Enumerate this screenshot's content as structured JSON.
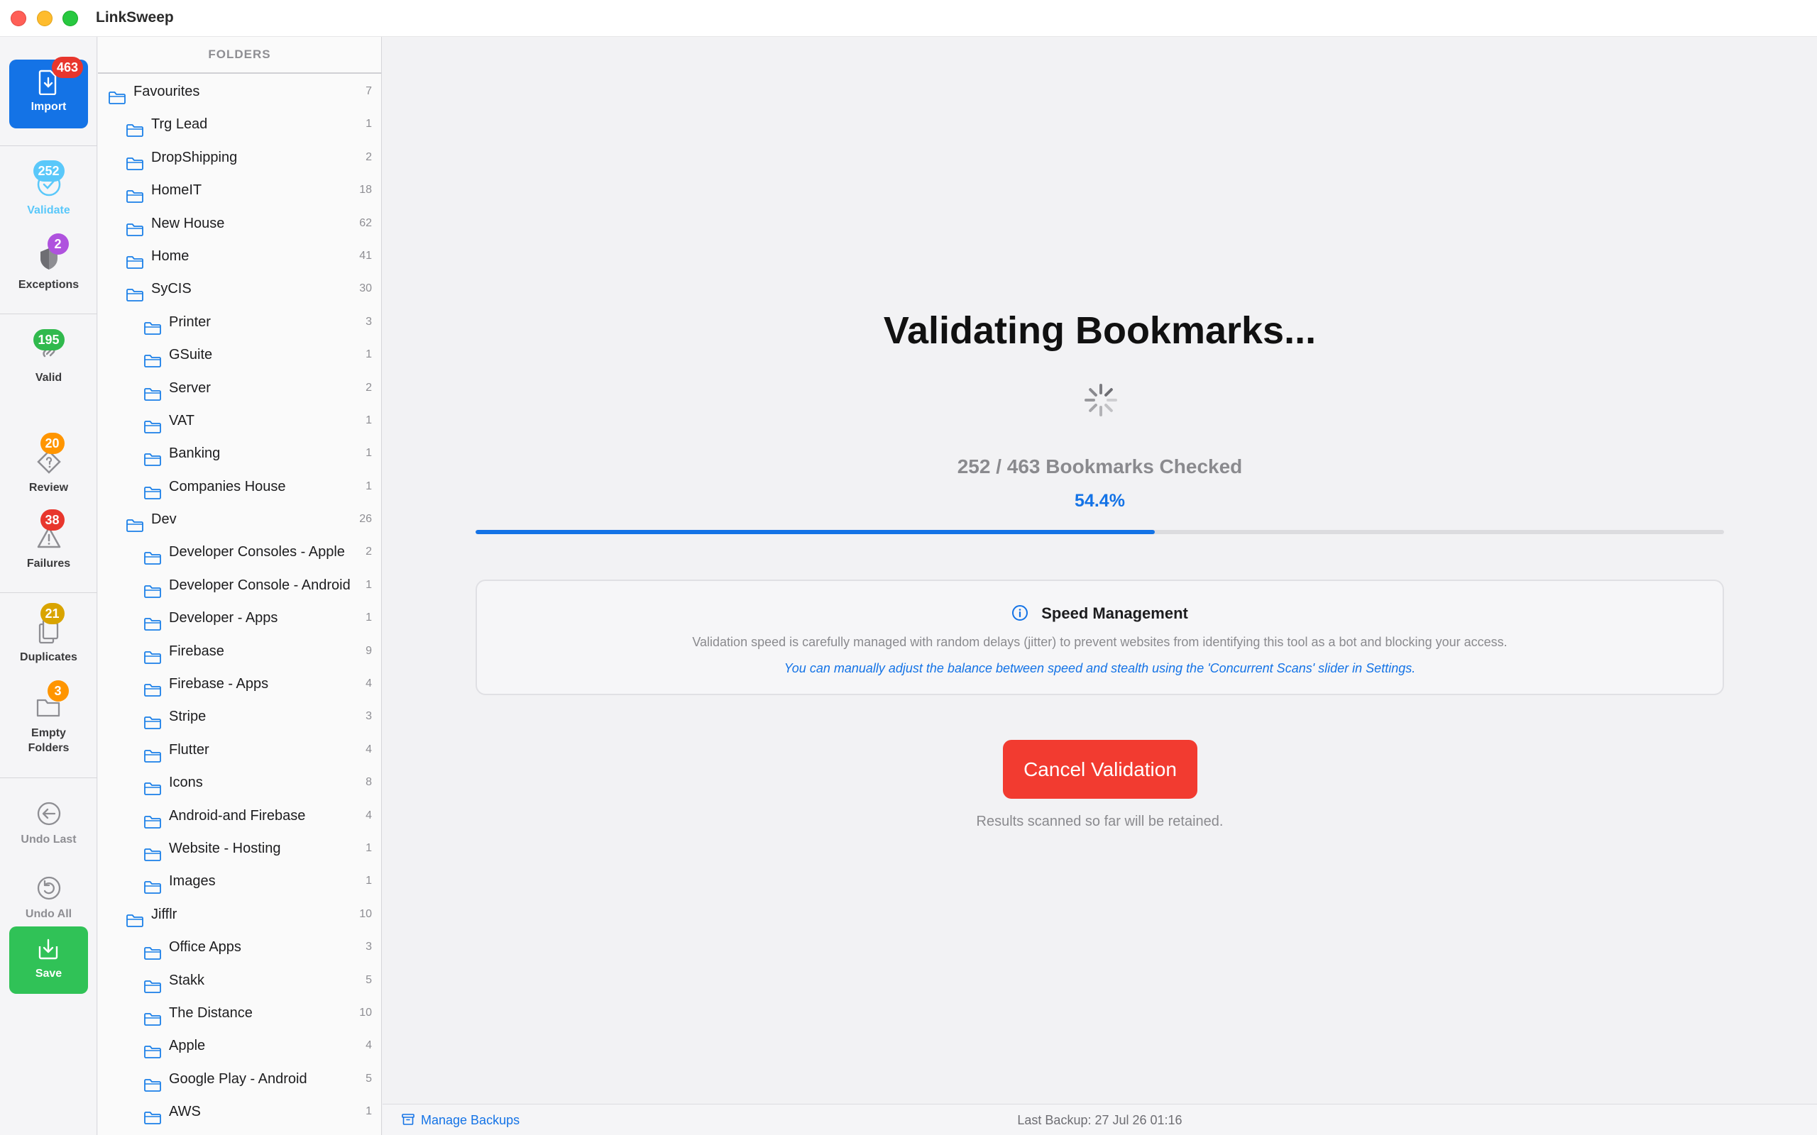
{
  "window": {
    "title": "LinkSweep"
  },
  "rail": {
    "import": {
      "label": "Import",
      "badge": "463",
      "badge_color": "#e8362d"
    },
    "validate": {
      "label": "Validate",
      "badge": "252",
      "badge_color": "#5ac8fa"
    },
    "exceptions": {
      "label": "Exceptions",
      "badge": "2",
      "badge_color": "#af52de"
    },
    "valid": {
      "label": "Valid",
      "badge": "195",
      "badge_color": "#30b94d"
    },
    "review": {
      "label": "Review",
      "badge": "20",
      "badge_color": "#ff9500"
    },
    "failures": {
      "label": "Failures",
      "badge": "38",
      "badge_color": "#e8362d"
    },
    "duplicates": {
      "label": "Duplicates",
      "badge": "21",
      "badge_color": "#d9a400"
    },
    "empty_folders": {
      "label_line1": "Empty",
      "label_line2": "Folders",
      "badge": "3",
      "badge_color": "#ff9500"
    },
    "undo_last": {
      "label": "Undo Last"
    },
    "undo_all": {
      "label": "Undo All"
    },
    "save": {
      "label": "Save"
    }
  },
  "folders": {
    "header": "FOLDERS",
    "items": [
      {
        "name": "Favourites",
        "count": "7",
        "level": 0
      },
      {
        "name": "Trg Lead",
        "count": "1",
        "level": 1
      },
      {
        "name": "DropShipping",
        "count": "2",
        "level": 1
      },
      {
        "name": "HomeIT",
        "count": "18",
        "level": 1
      },
      {
        "name": "New House",
        "count": "62",
        "level": 1
      },
      {
        "name": "Home",
        "count": "41",
        "level": 1
      },
      {
        "name": "SyCIS",
        "count": "30",
        "level": 1
      },
      {
        "name": "Printer",
        "count": "3",
        "level": 2
      },
      {
        "name": "GSuite",
        "count": "1",
        "level": 2
      },
      {
        "name": "Server",
        "count": "2",
        "level": 2
      },
      {
        "name": "VAT",
        "count": "1",
        "level": 2
      },
      {
        "name": "Banking",
        "count": "1",
        "level": 2
      },
      {
        "name": "Companies House",
        "count": "1",
        "level": 2
      },
      {
        "name": "Dev",
        "count": "26",
        "level": 1
      },
      {
        "name": "Developer Consoles - Apple",
        "count": "2",
        "level": 2
      },
      {
        "name": "Developer Console - Android",
        "count": "1",
        "level": 2
      },
      {
        "name": "Developer - Apps",
        "count": "1",
        "level": 2
      },
      {
        "name": "Firebase",
        "count": "9",
        "level": 2
      },
      {
        "name": "Firebase - Apps",
        "count": "4",
        "level": 2
      },
      {
        "name": "Stripe",
        "count": "3",
        "level": 2
      },
      {
        "name": "Flutter",
        "count": "4",
        "level": 2
      },
      {
        "name": "Icons",
        "count": "8",
        "level": 2
      },
      {
        "name": "Android-and Firebase",
        "count": "4",
        "level": 2
      },
      {
        "name": "Website - Hosting",
        "count": "1",
        "level": 2
      },
      {
        "name": "Images",
        "count": "1",
        "level": 2
      },
      {
        "name": "Jifflr",
        "count": "10",
        "level": 1
      },
      {
        "name": "Office Apps",
        "count": "3",
        "level": 2
      },
      {
        "name": "Stakk",
        "count": "5",
        "level": 2
      },
      {
        "name": "The Distance",
        "count": "10",
        "level": 2
      },
      {
        "name": "Apple",
        "count": "4",
        "level": 2
      },
      {
        "name": "Google Play - Android",
        "count": "5",
        "level": 2
      },
      {
        "name": "AWS",
        "count": "1",
        "level": 2
      }
    ]
  },
  "main": {
    "title": "Validating Bookmarks...",
    "checked_text": "252 / 463 Bookmarks Checked",
    "percent_text": "54.4%",
    "progress_fraction": 0.544,
    "speed": {
      "heading": "Speed Management",
      "description": "Validation speed is carefully managed with random delays (jitter) to prevent websites from identifying this tool as a bot and blocking your access.",
      "hint": "You can manually adjust the balance between speed and stealth using the 'Concurrent Scans' slider in Settings."
    },
    "cancel_label": "Cancel Validation",
    "retain_note": "Results scanned so far will be retained."
  },
  "footer": {
    "manage_backups": "Manage Backups",
    "last_backup": "Last Backup: 27 Jul 26 01:16"
  },
  "colors": {
    "accent": "#1473e6",
    "danger": "#f23b30",
    "save": "#30c257"
  }
}
